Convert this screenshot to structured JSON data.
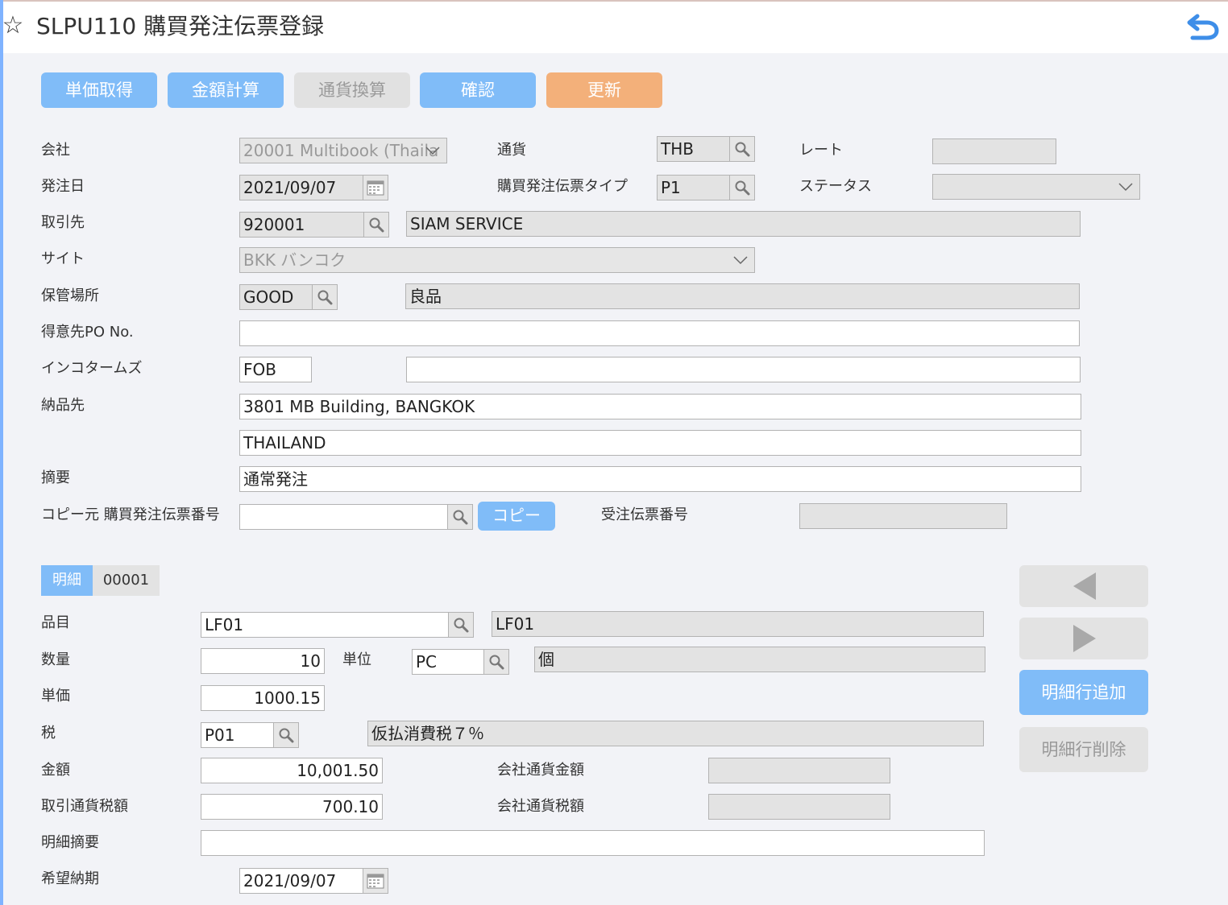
{
  "header": {
    "title": "SLPU110 購買発注伝票登録"
  },
  "toolbar": {
    "unit_price": "単価取得",
    "amount_calc": "金額計算",
    "currency_conv": "通貨換算",
    "confirm": "確認",
    "update": "更新"
  },
  "form": {
    "company": {
      "label": "会社",
      "value": "20001 Multibook (Thaila"
    },
    "currency": {
      "label": "通貨",
      "value": "THB"
    },
    "rate": {
      "label": "レート",
      "value": ""
    },
    "order_date": {
      "label": "発注日",
      "value": "2021/09/07"
    },
    "po_type": {
      "label": "購買発注伝票タイプ",
      "value": "P1"
    },
    "status": {
      "label": "ステータス",
      "value": ""
    },
    "vendor": {
      "label": "取引先",
      "code": "920001",
      "name": "SIAM SERVICE"
    },
    "site": {
      "label": "サイト",
      "value": "BKK バンコク"
    },
    "storage": {
      "label": "保管場所",
      "code": "GOOD",
      "name": "良品"
    },
    "customer_po": {
      "label": "得意先PO No.",
      "value": ""
    },
    "incoterms": {
      "label": "インコタームズ",
      "code": "FOB",
      "detail": ""
    },
    "delivery": {
      "label": "納品先",
      "line1": "3801 MB Building, BANGKOK",
      "line2": "THAILAND"
    },
    "summary": {
      "label": "摘要",
      "value": "通常発注"
    },
    "copy_source": {
      "label": "コピー元 購買発注伝票番号",
      "value": "",
      "button": "コピー"
    },
    "sales_order_no": {
      "label": "受注伝票番号",
      "value": ""
    }
  },
  "detail": {
    "tab_label": "明細",
    "line_no": "00001",
    "item": {
      "label": "品目",
      "code": "LF01",
      "name": "LF01"
    },
    "quantity": {
      "label": "数量",
      "value": "10"
    },
    "unit": {
      "label": "単位",
      "code": "PC",
      "name": "個"
    },
    "unit_price": {
      "label": "単価",
      "value": "1000.15"
    },
    "tax": {
      "label": "税",
      "code": "P01",
      "name": "仮払消費税７％"
    },
    "amount": {
      "label": "金額",
      "value": "10,001.50"
    },
    "company_amount": {
      "label": "会社通貨金額",
      "value": ""
    },
    "tax_amount": {
      "label": "取引通貨税額",
      "value": "700.10"
    },
    "company_tax": {
      "label": "会社通貨税額",
      "value": ""
    },
    "line_summary": {
      "label": "明細摘要",
      "value": ""
    },
    "desired_date": {
      "label": "希望納期",
      "value": "2021/09/07"
    }
  },
  "side_actions": {
    "add_line": "明細行追加",
    "delete_line": "明細行削除"
  },
  "colors": {
    "accent": "#80bcf8",
    "update": "#f3b07a",
    "readonly": "#e3e3e3"
  }
}
